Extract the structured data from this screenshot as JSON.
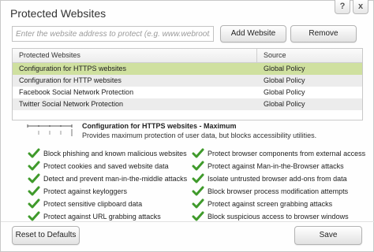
{
  "window": {
    "title": "Protected Websites",
    "help_label": "?",
    "close_label": "x"
  },
  "toolbar": {
    "url_placeholder": "Enter the website address to protect (e.g. www.webroot.com)",
    "add_label": "Add Website",
    "remove_label": "Remove"
  },
  "table": {
    "columns": [
      "Protected Websites",
      "Source"
    ],
    "rows": [
      {
        "name": "Configuration for HTTPS websites",
        "source": "Global Policy",
        "selected": true
      },
      {
        "name": "Configuration for HTTP websites",
        "source": "Global Policy",
        "selected": false
      },
      {
        "name": "Facebook Social Network Protection",
        "source": "Global Policy",
        "selected": false
      },
      {
        "name": "Twitter Social Network Protection",
        "source": "Global Policy",
        "selected": false
      }
    ]
  },
  "detail": {
    "title": "Configuration for HTTPS websites - Maximum",
    "description": "Provides maximum protection of user data, but blocks accessibility utilities.",
    "protection_level": "Maximum"
  },
  "features": {
    "left": [
      "Block phishing and known malicious websites",
      "Protect cookies and saved website data",
      "Detect and prevent man-in-the-middle attacks",
      "Protect against keyloggers",
      "Protect sensitive clipboard data",
      "Protect against URL grabbing attacks"
    ],
    "right": [
      "Protect browser components from external access",
      "Protect against Man-in-the-Browser attacks",
      "Isolate untrusted browser add-ons from data",
      "Block browser process modification attempts",
      "Protect against screen grabbing attacks",
      "Block suspicious access to browser windows"
    ]
  },
  "footer": {
    "reset_label": "Reset to Defaults",
    "save_label": "Save"
  },
  "colors": {
    "selected_row": "#cfe09f",
    "check_green": "#3f9a2b"
  },
  "icons": [
    "help-icon",
    "close-icon",
    "slider-icon",
    "check-icon"
  ]
}
